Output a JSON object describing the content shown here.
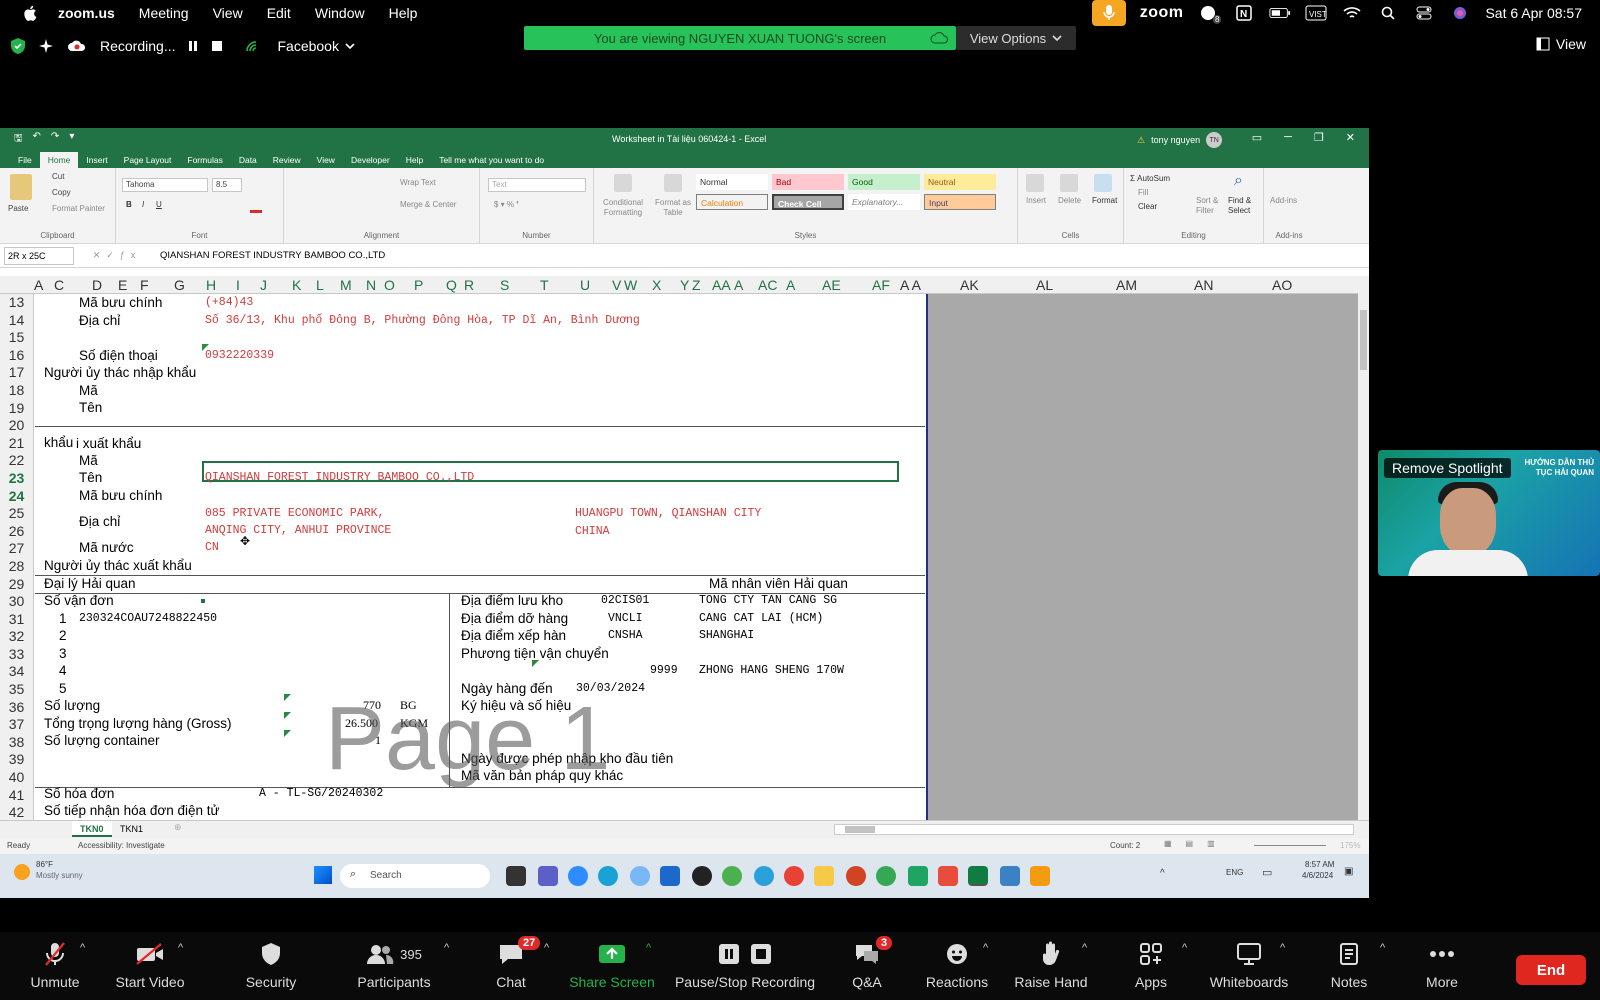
{
  "menubar": {
    "app": "zoom.us",
    "items": [
      "Meeting",
      "View",
      "Edit",
      "Window",
      "Help"
    ],
    "zoom_label": "zoom",
    "datetime": "Sat 6 Apr  08:57",
    "notif_badge": "8"
  },
  "zoom_top": {
    "recording": "Recording...",
    "facebook": "Facebook",
    "banner": "You are viewing NGUYEN XUAN TUONG's screen",
    "view_options": "View Options",
    "view": "View"
  },
  "excel": {
    "title": "Worksheet in Tài liệu 060424-1  -  Excel",
    "user": "tony nguyen",
    "user_initials": "TN",
    "tabs": [
      "File",
      "Home",
      "Insert",
      "Page Layout",
      "Formulas",
      "Data",
      "Review",
      "View",
      "Developer",
      "Help",
      "Tell me what you want to do"
    ],
    "ribbon": {
      "paste": "Paste",
      "cut": "Cut",
      "copy": "Copy",
      "format_painter": "Format Painter",
      "clipboard": "Clipboard",
      "font_name": "Tahoma",
      "font_size": "8.5",
      "font": "Font",
      "wrap_text": "Wrap Text",
      "merge_center": "Merge & Center",
      "alignment": "Alignment",
      "number_format": "Text",
      "number": "Number",
      "conditional": "Conditional Formatting",
      "format_as": "Format as Table",
      "styles_label": "Styles",
      "styles": [
        "Normal",
        "Bad",
        "Good",
        "Neutral",
        "Calculation",
        "Check Cell",
        "Explanatory...",
        "Input"
      ],
      "insert": "Insert",
      "delete": "Delete",
      "format": "Format",
      "cells": "Cells",
      "autosum": "AutoSum",
      "fill": "Fill",
      "clear": "Clear",
      "sort_filter": "Sort & Filter",
      "find_select": "Find & Select",
      "editing": "Editing",
      "addins": "Add-ins"
    },
    "name_box": "2R x 25C",
    "formula": "QIANSHAN FOREST INDUSTRY BAMBOO CO.,LTD",
    "columns": [
      "A",
      "C",
      "D",
      "E",
      "F",
      "G",
      "H",
      "I",
      "J",
      "K",
      "L",
      "M",
      "N",
      "O",
      "P",
      "Q",
      "R",
      "S",
      "T",
      "U",
      "V",
      "W",
      "X",
      "Y",
      "Z",
      "AA",
      "A",
      "AC",
      "A",
      "AE",
      "AF",
      "A A",
      "AK",
      "AL",
      "AM",
      "AN",
      "AO"
    ],
    "rows": [
      "13",
      "14",
      "15",
      "16",
      "17",
      "18",
      "19",
      "20",
      "21",
      "22",
      "23",
      "24",
      "25",
      "26",
      "27",
      "28",
      "29",
      "30",
      "31",
      "32",
      "33",
      "34",
      "35",
      "36",
      "37",
      "38",
      "39",
      "40",
      "41",
      "42"
    ],
    "cells": {
      "r13_label": "Mã bưu chính",
      "r13_val": "(+84)43",
      "r14_label": "Địa chỉ",
      "r14_val": "Số 36/13, Khu phố Đông B, Phường Đông Hòa, TP Dĩ An, Bình Dương",
      "r16_label": "Số điện thoại",
      "r16_val": "0932220339",
      "r17_label": "Người ủy thác nhập khẩu",
      "r18_label": "Mã",
      "r19_label": "Tên",
      "r21_label": "khẩu",
      "r21_label2": "i xuất khẩu",
      "r22_label": "Mã",
      "r23_label": "Tên",
      "r23_val": "QIANSHAN FOREST INDUSTRY BAMBOO CO.,LTD",
      "r24_label": "Mã bưu chính",
      "r25_val1": "085 PRIVATE ECONOMIC PARK,",
      "r25_val2": "HUANGPU TOWN, QIANSHAN CITY",
      "r26_label": "Địa chỉ",
      "r26_val1": "ANQING CITY, ANHUI PROVINCE",
      "r26_val2": "CHINA",
      "r27_label": "Mã nước",
      "r27_val": "CN",
      "r28_label": "Người ủy thác xuất khẩu",
      "r29_label": "Đại lý Hải quan",
      "r29_right": "Mã nhân viên Hải quan",
      "r30_label": "Số vận đơn",
      "r30_r_label": "Địa điểm lưu kho",
      "r30_r_code": "02CIS01",
      "r30_r_name": "TONG CTY TAN CANG SG",
      "r31_n": "1",
      "r31_val": "230324COAU7248822450",
      "r31_r_label": "Địa điểm dỡ hàng",
      "r31_r_code": "VNCLI",
      "r31_r_name": "CANG CAT LAI (HCM)",
      "r32_n": "2",
      "r32_r_label": "Địa điểm xếp hàn",
      "r32_r_code": "CNSHA",
      "r32_r_name": "SHANGHAI",
      "r33_n": "3",
      "r33_r_label": "Phương tiện vận chuyển",
      "r34_n": "4",
      "r34_r_code": "9999",
      "r34_r_name": "ZHONG HANG SHENG 170W",
      "r35_n": "5",
      "r35_r_label": "Ngày hàng đến",
      "r35_r_val": "30/03/2024",
      "r36_label": "Số lượng",
      "r36_val": "770",
      "r36_unit": "BG",
      "r36_r_label": "Ký hiệu và số hiệu",
      "r37_label": "Tổng trọng lượng hàng (Gross)",
      "r37_val": "26.500",
      "r37_unit": "KGM",
      "r38_label": "Số lượng container",
      "r38_val": "1",
      "r39_r_label": "Ngày được phép nhập kho đầu tiên",
      "r40_r_label": "Mã văn bản pháp quy khác",
      "r41_label": "Số hóa đơn",
      "r41_val": "A - TL-SG/20240302",
      "r42_label": "Số tiếp nhận hóa đơn điện tử"
    },
    "watermark": "Page 1",
    "sheets": [
      "TKN0",
      "TKN1"
    ],
    "status_ready": "Ready",
    "accessibility": "Accessibility: Investigate",
    "count": "Count: 2",
    "zoom_pct": "175%"
  },
  "taskbar": {
    "weather_temp": "86°F",
    "weather_desc": "Mostly sunny",
    "search": "Search",
    "lang": "ENG",
    "time": "8:57 AM",
    "date": "4/6/2024"
  },
  "spotlight": {
    "remove": "Remove Spotlight",
    "corner": "HƯỚNG DẪN THỦ TỤC HẢI QUAN"
  },
  "controls": {
    "unmute": "Unmute",
    "start_video": "Start Video",
    "security": "Security",
    "participants": "Participants",
    "participants_count": "395",
    "chat": "Chat",
    "chat_badge": "27",
    "share_screen": "Share Screen",
    "pause_stop": "Pause/Stop Recording",
    "qa": "Q&A",
    "qa_badge": "3",
    "reactions": "Reactions",
    "raise_hand": "Raise Hand",
    "apps": "Apps",
    "whiteboards": "Whiteboards",
    "notes": "Notes",
    "more": "More",
    "end": "End"
  },
  "colors": {
    "excel_green": "#217346",
    "zoom_banner": "#27c25a",
    "end_red": "#e0271f",
    "cell_red": "#d23b3b"
  }
}
